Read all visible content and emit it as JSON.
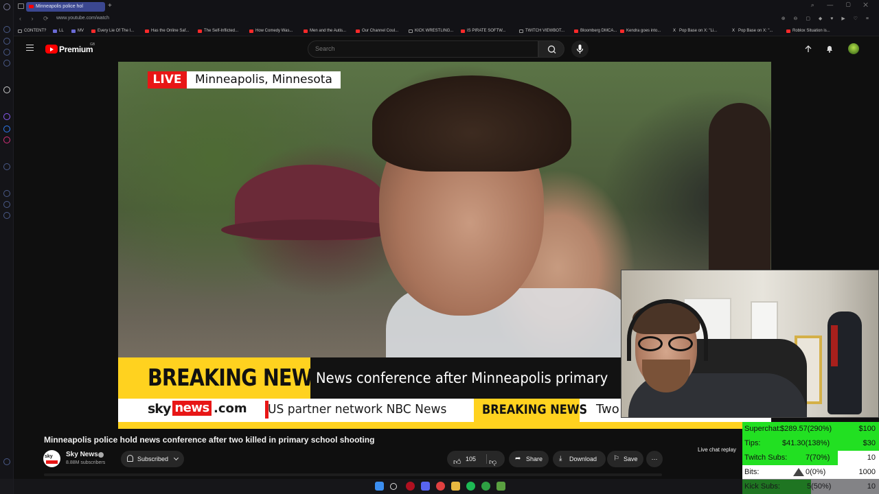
{
  "browser": {
    "tab_title": "Minneapolis police hol",
    "new_tab": "+",
    "url": "www.youtube.com/watch",
    "bookmarks": [
      {
        "label": "CONTENT?",
        "kind": "folder"
      },
      {
        "label": "LL",
        "kind": "other"
      },
      {
        "label": "MV",
        "kind": "other"
      },
      {
        "label": "Every Lie Of The I...",
        "kind": "yt"
      },
      {
        "label": "Has the Online Saf...",
        "kind": "yt"
      },
      {
        "label": "The Self-Inflicted...",
        "kind": "yt"
      },
      {
        "label": "How Comedy Was...",
        "kind": "yt"
      },
      {
        "label": "Men and the Autis...",
        "kind": "yt"
      },
      {
        "label": "Our Channel Coul...",
        "kind": "yt"
      },
      {
        "label": "KICK WRESTLING...",
        "kind": "folder"
      },
      {
        "label": "IS PIRATE SOFTW...",
        "kind": "yt"
      },
      {
        "label": "TWITCH VIEWBOT...",
        "kind": "folder"
      },
      {
        "label": "Bloomberg DMCA...",
        "kind": "yt"
      },
      {
        "label": "Kendra goes into...",
        "kind": "yt"
      },
      {
        "label": "Pop Base on X: \"Li...",
        "kind": "x"
      },
      {
        "label": "Pop Base on X: \"...",
        "kind": "x"
      },
      {
        "label": "Roblox Situation is...",
        "kind": "yt"
      }
    ]
  },
  "youtube": {
    "brand": "Premium",
    "country": "GB",
    "search_placeholder": "Search"
  },
  "video": {
    "live_label": "LIVE",
    "location": "Minneapolis, Minnesota",
    "breaking_label": "BREAKING NEWS",
    "breaking_headline": "News conference after Minneapolis primary",
    "sky_logo": "sky",
    "news_logo": "news",
    "dotcom": ".com",
    "ticker_text": "US partner network NBC News",
    "ticker_breaking": "BREAKING NEWS",
    "ticker_tail": "Two"
  },
  "info": {
    "title": "Minneapolis police hold news conference after two killed in primary school shooting",
    "channel_name": "Sky News",
    "channel_avatar_text": "sky",
    "subscribers": "8.88M subscribers",
    "subscribed_label": "Subscribed",
    "likes": "105",
    "share_label": "Share",
    "download_label": "Download",
    "save_label": "Save",
    "more_label": "⋯",
    "live_chat_replay": "Live chat replay"
  },
  "stats": {
    "rows": [
      {
        "label": "Superchat:",
        "value": "$289.57(290%)",
        "goal": "$100",
        "fill": 1.0
      },
      {
        "label": "Tips:",
        "value": "$41.30(138%)",
        "goal": "$30",
        "fill": 1.0
      },
      {
        "label": "Twitch Subs:",
        "value": "7(70%)",
        "goal": "10",
        "fill": 0.7
      },
      {
        "label": "Bits:",
        "value": "0(0%)",
        "goal": "1000",
        "fill": 0.0
      },
      {
        "label": "Kick Subs:",
        "value": "5(50%)",
        "goal": "10",
        "fill": 0.5
      }
    ]
  },
  "colors": {
    "accent_red": "#ff0000",
    "sky_yellow": "#ffd21f",
    "sky_red": "#e81616",
    "stats_green": "#22e022"
  }
}
